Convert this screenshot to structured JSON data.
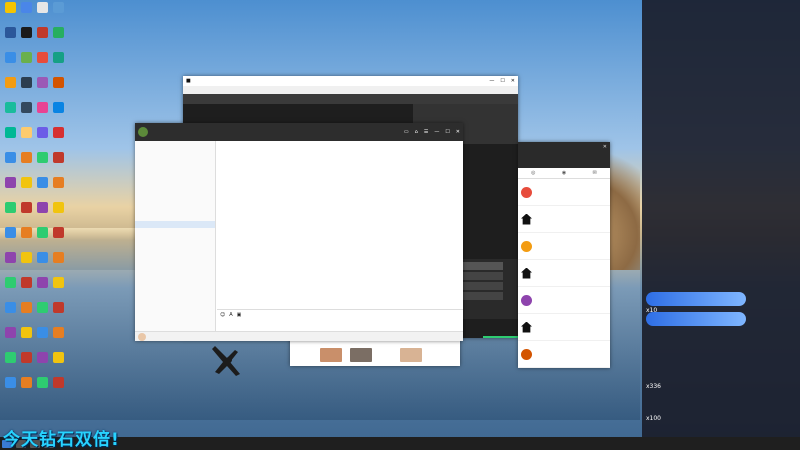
{
  "desktop": {
    "icons": [
      {
        "label": "",
        "color": "#f5c400"
      },
      {
        "label": "",
        "color": "#4a86e8"
      },
      {
        "label": "",
        "color": "#e6e6e6"
      },
      {
        "label": "",
        "color": "#5b9bd5"
      },
      {
        "label": "",
        "color": "#2b579a"
      },
      {
        "label": "",
        "color": "#1b1b1b"
      },
      {
        "label": "",
        "color": "#c0392b"
      },
      {
        "label": "",
        "color": "#27ae60"
      },
      {
        "label": "",
        "color": "#3a8ee6"
      },
      {
        "label": "",
        "color": "#6ab04c"
      },
      {
        "label": "",
        "color": "#e74c3c"
      },
      {
        "label": "",
        "color": "#16a085"
      },
      {
        "label": "",
        "color": "#f39c12"
      },
      {
        "label": "",
        "color": "#2c3e50"
      },
      {
        "label": "",
        "color": "#9b59b6"
      },
      {
        "label": "",
        "color": "#d35400"
      },
      {
        "label": "",
        "color": "#1abc9c"
      },
      {
        "label": "",
        "color": "#34495e"
      },
      {
        "label": "",
        "color": "#e84393"
      },
      {
        "label": "",
        "color": "#0984e3"
      },
      {
        "label": "",
        "color": "#00b894"
      },
      {
        "label": "",
        "color": "#fdcb6e"
      },
      {
        "label": "",
        "color": "#6c5ce7"
      },
      {
        "label": "",
        "color": "#d63031"
      }
    ]
  },
  "chat_window": {
    "title": "",
    "contacts": [
      "",
      "",
      "",
      "",
      "",
      "",
      "",
      "",
      "",
      "",
      "",
      "",
      "",
      "",
      "",
      "",
      "",
      "",
      "",
      "",
      "",
      "",
      "",
      "",
      "",
      "",
      "",
      "",
      ""
    ],
    "messages": [
      {
        "name": "",
        "content": ""
      },
      {
        "name": "",
        "content": ""
      },
      {
        "name": "",
        "content": ""
      },
      {
        "name": "",
        "content": ""
      },
      {
        "name": "",
        "content": ""
      },
      {
        "name": "",
        "content": ""
      },
      {
        "name": "",
        "content": ""
      },
      {
        "name": "",
        "content": ""
      },
      {
        "name": "",
        "content": ""
      },
      {
        "name": "",
        "content": ""
      },
      {
        "name": "",
        "content": ""
      },
      {
        "name": "",
        "content": ""
      },
      {
        "name": "",
        "content": ""
      },
      {
        "name": "",
        "content": ""
      },
      {
        "name": "",
        "content": ""
      },
      {
        "name": "",
        "content": ""
      },
      {
        "name": "",
        "content": ""
      },
      {
        "name": "",
        "content": ""
      },
      {
        "name": "",
        "content": ""
      },
      {
        "name": "",
        "content": ""
      }
    ],
    "input_placeholder": ""
  },
  "right_window": {
    "items": [
      {
        "name": "",
        "sub": ""
      },
      {
        "name": "",
        "sub": ""
      },
      {
        "name": "",
        "sub": ""
      },
      {
        "name": "",
        "sub": ""
      },
      {
        "name": "",
        "sub": ""
      },
      {
        "name": "",
        "sub": ""
      },
      {
        "name": "",
        "sub": ""
      }
    ]
  },
  "danmaku": {
    "stats": "",
    "badge_lines": [
      "",
      "",
      "",
      "",
      "",
      "",
      "",
      "",
      "",
      "",
      ""
    ],
    "gift_lines": [
      {
        "user": "",
        "text": ""
      },
      {
        "user": "",
        "text": ""
      },
      {
        "user": "",
        "text": ""
      },
      {
        "user": "",
        "text": ""
      },
      {
        "user": "",
        "text": ""
      },
      {
        "user": "",
        "text": ""
      },
      {
        "user": "",
        "text": ""
      },
      {
        "user": "",
        "text": ""
      }
    ],
    "combos": [
      "x10",
      "x336",
      "x100"
    ]
  },
  "overlay_text": "今天钻石双倍!",
  "taskbar": {
    "clock": ""
  },
  "colors": {
    "overlay": "#28d3ff",
    "badge": "#9b59d6",
    "gift_banner": "#2e6ee6"
  }
}
